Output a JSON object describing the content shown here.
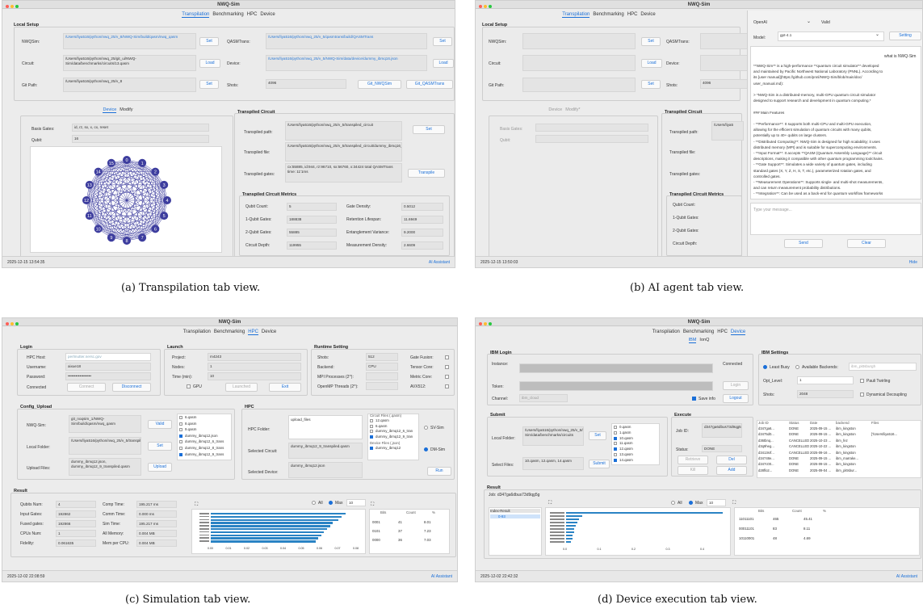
{
  "app_title": "NWQ-Sim",
  "colors": {
    "accent": "#1a6fd8",
    "bar": "#2a83c4",
    "graph": "#3d3d9e"
  },
  "captions": [
    "(a) Transpilation tab view.",
    "(b) AI agent tab view.",
    "(c) Simulation tab view.",
    "(d) Device execution tab view."
  ],
  "tabs": {
    "transpilation": "Transpilation",
    "benchmarking": "Benchmarking",
    "hpc": "HPC",
    "device": "Device"
  },
  "ai_assistant": "AI Assistant",
  "a": {
    "local_setup": "Local Setup",
    "nwqsim_label": "NWQSim:",
    "nwqsim_value": "/Users/liya516/python/nwq_25/v_8/NWQ-Sim/build/qasm/nwq_qasm",
    "qasmtrans_label": "QASMTrans:",
    "qasmtrans_value": "/Users/liya516/python/nwq_25/v_5/qasmtrans/build/QASMTrans",
    "circuit_label": "Circuit:",
    "circuit_value": "/Users/liya516/python/nwq_25/git_ui/NWQ-Sim/data/benchmarks/circuits/13.qasm",
    "device_label": "Device:",
    "device_value": "/Users/liya516/python/nwq_25/v_5/NWQ-Sim/data/device/dummy_ibmq16.json",
    "gitpath_label": "Git Path:",
    "gitpath_value": "/Users/liya516/python/nwq_25/v_8",
    "shots_label": "Shots:",
    "shots_value": "4096",
    "set": "Set",
    "load": "Load",
    "git_nwqsim": "Git_NWQSim",
    "git_qasmtrans": "Git_QASMTrans",
    "device_tab": "Device",
    "modify_tab": "Modify",
    "basis_label": "Basis Gates:",
    "basis_value": "id, rz, sx, x, cx, reset",
    "qubit_label": "Qubit:",
    "qubit_value": "16",
    "transpiled_circuit": "Transpiled Circuit",
    "tpath_label": "Transpiled path:",
    "tpath_value": "/Users/liya516/python/nwq_25/v_5/transpiled_circuit",
    "tfile_label": "Transpiled file:",
    "tfile_value": "/Users/liya516/python/nwq_25/v_5/transpiled_circuit/dummy_ibmq16_13_transpiled.qasm",
    "tgates_label": "Transpiled gates:",
    "tgates_value": "cx:55885, id:944, rz:96710, sx:56760, x:34424 total QASMTrans time: 11'1ms",
    "transpile": "Transpile",
    "metrics_title": "Transpiled Circuit Metrics",
    "metrics": [
      {
        "l1": "Qubit Count:",
        "v1": "5",
        "l2": "Gate Density:",
        "v2": "0.5012"
      },
      {
        "l1": "1-Qubit Gates:",
        "v1": "188838",
        "l2": "Retention Lifespan:",
        "v2": "11.6949"
      },
      {
        "l1": "2-Qubit Gates:",
        "v1": "55885",
        "l2": "Entanglement Variance:",
        "v2": "9.2000"
      },
      {
        "l1": "Circuit Depth:",
        "v1": "119955",
        "l2": "Measurement Density:",
        "v2": "2.6609"
      }
    ],
    "graph_nodes": [
      "0",
      "1",
      "2",
      "3",
      "4",
      "5",
      "6",
      "7",
      "8",
      "9",
      "10",
      "11",
      "12",
      "13",
      "14",
      "15"
    ],
    "timestamp": "2025-12-15 13:54:35"
  },
  "b": {
    "provider": "OpenAI",
    "valid": "Valid",
    "model_label": "Model:",
    "model_value": "gpt-4.1",
    "setting": "Setting",
    "question": "what is NWQ-Sim",
    "lines": [
      "**NWQ-Sim** is a high-performance **quantum circuit simulator** developed",
      "and maintained by Pacific Northwest National Laboratory (PNNL). According to",
      "its [user manual](https://github.com/pnnl/NWQ-Sim/blob/main/doc/",
      "user_manual.md):",
      "",
      "> *NWQ-Sim is a distributed-memory, multi-GPU quantum circuit simulator",
      "designed to support research and development in quantum computing.*",
      "",
      "### Main Features",
      "",
      "- **Performance**: It supports both multi-CPU and multi-GPU execution,",
      "allowing for the efficient simulation of quantum circuits with many qubits,",
      "potentially up to 40+ qubits on large clusters.",
      "- **Distributed Computing**: NWQ-Sim is designed for high scalability; it uses",
      "distributed memory (MPI) and is suitable for supercomputing environments.",
      "- **Input Format**: It accepts **QASM (Quantum Assembly Language)** circuit",
      "descriptions, making it compatible with other quantum programming toolchains.",
      "- **Gate Support**: Simulates a wide variety of quantum gates, including",
      "standard gates (X, Y, Z, H, S, T, etc.), parameterized rotation gates, and",
      "controlled gates.",
      "- **Measurement Operations**: Supports single- and multi-shot measurements,",
      "and can return measurement probability distributions.",
      "- **Integration**: Can be used as a back-end for quantum workflow frameworks"
    ],
    "placeholder": "Type your message...",
    "send": "Send",
    "clear": "Clear",
    "hide": "Hide",
    "device_tab": "Device",
    "modify_tab": "Modify*",
    "left_labels": [
      "NWQSim:",
      "Circuit:",
      "Git Path:"
    ],
    "mid_labels": [
      "QASMTrans:",
      "Device:",
      "Shots:"
    ],
    "shots_value": "4096",
    "basis_label": "Basis Gates:",
    "qubit_label": "Qubit:",
    "tc_labels": [
      "Transpiled path:",
      "Transpiled file:",
      "Transpiled gates:"
    ],
    "tpath_value": "/Users/liya5",
    "metrics_labels": [
      "Qubit Count:",
      "1-Qubit Gates:",
      "2-Qubit Gates:",
      "Circuit Depth:"
    ],
    "timestamp": "2025-12-15 13:50:03"
  },
  "c": {
    "login": "Login",
    "host_label": "HPC Host:",
    "host_value": "perlmutter.nersc.gov",
    "user_label": "Username:",
    "user_value": "aixue18",
    "pass_label": "Password:",
    "pass_value": "••••••••••••••••••",
    "connected": "Connected",
    "connect": "Connect",
    "disconnect": "Disconnect",
    "launch": "Launch",
    "project_label": "Project:",
    "project_value": "m4243",
    "nodes_label": "Nodes:",
    "nodes_value": "1",
    "time_label": "Time (min):",
    "time_value": "10",
    "gpu": "GPU",
    "launched": "Launched",
    "exit": "Exit",
    "runtime": "Runtime Setting",
    "shots_label": "Shots:",
    "shots_value": "512",
    "backend_label": "Backend:",
    "backend_value": "CPU",
    "mpi_label": "MPI Processes (2^):",
    "omp_label": "OpenMP Threads (2^):",
    "gate_fusion": "Gate Fusion:",
    "tensor_core": "Tensor Core:",
    "metric_core": "Metric Core:",
    "avx": "AVX512:",
    "config": "Config_Upload",
    "nwqsim_label": "NWQ-Sim:",
    "nwqsim_value": "git_noqsim_1/NWQ-Sim/build/qasm/nwq_qasm",
    "valid": "Valid",
    "folder_label": "Local Folder:",
    "folder_value": "/Users/liya516/python/nwq_25/v_5/transpiled_circuit",
    "set": "Set",
    "upload_label": "Upload Files:",
    "upload_value": "dummy_ibmq12.json, dummy_ibmq12_9_transpiled.qasm",
    "upload": "Upload",
    "files": [
      "6.qasm",
      "8.qasm",
      "9.qasm",
      "dummy_ibmq12.json",
      "dummy_ibmq12_6_trans",
      "dummy_ibmq12_8_trans",
      "dummy_ibmq12_9_trans"
    ],
    "hpc": "HPC",
    "hpc_folder_label": "HPC Folder:",
    "hpc_folder_value": "upload_files",
    "circuit_files": "Circuit Files (.qasm)",
    "cfiles": [
      "12.qasm",
      "6.qasm",
      "dummy_ibmq12_6_tran",
      "dummy_ibmq12_9_tran"
    ],
    "device_files": "Device Files (.json)",
    "dfiles": [
      "dummy_ibmq12"
    ],
    "sv_sim": "SV-Sim",
    "dm_sim": "DM-Sim",
    "run": "Run",
    "sel_circ_label": "Selected Circuit:",
    "sel_circ_value": "dummy_ibmq12_9_transpiled.qasm",
    "sel_dev_label": "Selected Device:",
    "sel_dev_value": "dummy_ibmq12.json",
    "result": "Result",
    "stats": [
      {
        "l1": "Qubits Num:",
        "v1": "4",
        "l2": "Comp Time:",
        "v2": "195.217 ms"
      },
      {
        "l1": "Input Gates:",
        "v1": "192862",
        "l2": "Comm Time:",
        "v2": "0.000 ms"
      },
      {
        "l1": "Fused gates:",
        "v1": "192866",
        "l2": "Sim Time:",
        "v2": "195.217 ms"
      },
      {
        "l1": "CPUs Num:",
        "v1": "1",
        "l2": "All Memory:",
        "v2": "0.004 MB"
      },
      {
        "l1": "Fidelity:",
        "v1": "0.061635",
        "l2": "Mem per CPU:",
        "v2": "0.004 MB"
      }
    ],
    "all": "All",
    "max": "Max",
    "max_value": "10",
    "xticks": [
      "0.00",
      "0.01",
      "0.02",
      "0.03",
      "0.04",
      "0.05",
      "0.06",
      "0.07",
      "0.08"
    ],
    "bar_fracs": [
      0.93,
      0.9,
      0.88,
      0.84,
      0.82,
      0.8,
      0.78,
      0.76,
      0.74,
      0.72
    ],
    "table_headers": [
      "Bits",
      "Count",
      "%"
    ],
    "table_rows": [
      [
        "0001",
        "41",
        "8.01"
      ],
      [
        "0101",
        "37",
        "7.23"
      ],
      [
        "0000",
        "36",
        "7.03"
      ]
    ],
    "timestamp": "2025-12-02 22:08:59"
  },
  "d": {
    "subtabs": [
      "IBM",
      "IonQ"
    ],
    "ibm_login": "IBM Login",
    "instance_label": "Instance:",
    "connected": "Connected",
    "token_label": "Token:",
    "login": "Login",
    "channel_label": "Channel:",
    "channel_value": "ibm_cloud",
    "save_info": "Save info",
    "logout": "Logout",
    "settings": "IBM Settings",
    "least_busy": "Least Busy",
    "all_backends": "Available Backends:",
    "backend_value": "ibm_pittsburgh",
    "opt_label": "Opt_Level:",
    "opt_value": "1",
    "pauli": "Pauli Twirling",
    "shots_label": "Shots:",
    "shots_value": "2048",
    "decoupling": "Dynamical Decoupling",
    "submit": "Submit",
    "folder_label": "Local Folder:",
    "folder_value": "/Users/liya516/python/nwq_25/v_6/NWQ-Sim/data/benchmarks/circuits",
    "set": "Set",
    "files": [
      "0.qasm",
      "1.qasm",
      "10.qasm",
      "11.qasm",
      "12.qasm",
      "13.qasm",
      "14.qasm"
    ],
    "select_label": "Select Files:",
    "select_value": "10.qasm, 12.qasm, 14.qasm",
    "submit_btn": "Submit",
    "execute": "Execute",
    "jobid_label": "Job ID:",
    "jobid_value": "d347ga6dbus73d9qg5g",
    "status_label": "Status:",
    "status_value": "DONE",
    "retrieve": "Retrieve",
    "del": "Del",
    "kill": "Kill",
    "add": "Add",
    "job_headers": [
      "Job ID",
      "Status",
      "Date",
      "backend",
      "Files"
    ],
    "jobs": [
      [
        "d347ga6...",
        "DONE",
        "2025-09-15 ...",
        "ibm_kingston",
        ""
      ],
      [
        "d3475d0...",
        "DONE",
        "2025-09-15 ...",
        "ibm_kingston",
        "['/Users/liya516..."
      ],
      [
        "d36tbnq...",
        "CANCELLED",
        "2025-10-23 ...",
        "ibm_fez",
        ""
      ],
      [
        "d3q9heg...",
        "CANCELLED",
        "2025-10-22 ...",
        "ibm_kingston",
        ""
      ],
      [
        "d3413srf...",
        "CANCELLED",
        "2025-09-16 ...",
        "ibm_kingston",
        ""
      ],
      [
        "d34748e...",
        "DONE",
        "2025-09-15 ...",
        "ibm_marrake...",
        ""
      ],
      [
        "d347c00...",
        "DONE",
        "2025-09-15 ...",
        "ibm_kingston",
        ""
      ],
      [
        "d28flo2...",
        "DONE",
        "2025-09-04 ...",
        "ibm_pittsbur...",
        ""
      ]
    ],
    "result": "Result",
    "job_line": "Job: d347ga6dbus73d9qg5g",
    "index_result": "Index-Result",
    "index_item": "0-93",
    "all": "All",
    "max": "Max",
    "max_value": "10",
    "xticks": [
      "0.0",
      "0.1",
      "0.2",
      "0.3",
      "0.4"
    ],
    "bar_fracs": [
      0.97,
      0.1,
      0.08,
      0.07,
      0.06,
      0.05,
      0.05,
      0.04,
      0.04,
      0.03
    ],
    "table_headers": [
      "Bits",
      "Count",
      "%"
    ],
    "table_rows": [
      [
        "11011101",
        "465",
        "45.41"
      ],
      [
        "00011101",
        "83",
        "8.11"
      ],
      [
        "10110001",
        "48",
        "4.69"
      ]
    ],
    "timestamp": "2025-12-02 22:42:32"
  }
}
